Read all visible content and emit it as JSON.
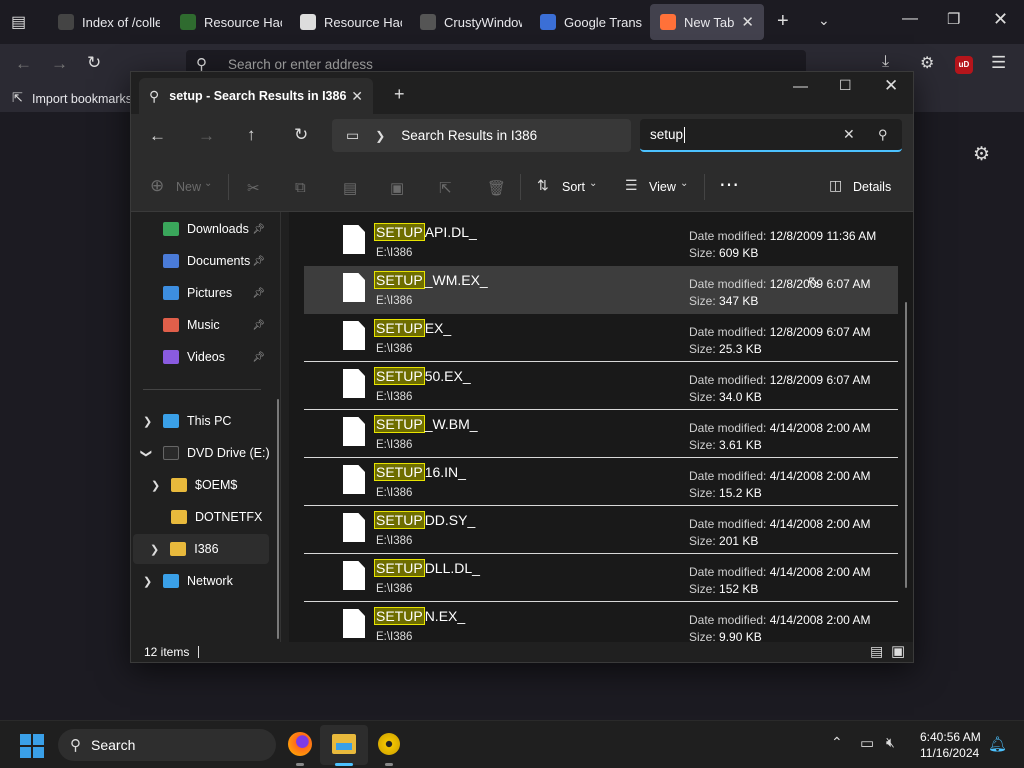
{
  "browser": {
    "tabs": [
      {
        "label": "Index of /colle",
        "icon": "wayback-icon"
      },
      {
        "label": "Resource Hack",
        "icon": "resource-hacker-icon"
      },
      {
        "label": "Resource Hack",
        "icon": "wikipedia-icon"
      },
      {
        "label": "CrustyWindow",
        "icon": "github-icon"
      },
      {
        "label": "Google Transla",
        "icon": "google-translate-icon"
      },
      {
        "label": "New Tab",
        "icon": "firefox-icon"
      }
    ],
    "address_placeholder": "Search or enter address",
    "bookmark_label": "Import bookmarks..."
  },
  "explorer": {
    "tab_title": "setup - Search Results in I386",
    "breadcrumb": "Search Results in I386",
    "search_value": "setup",
    "toolbar": {
      "new_label": "New",
      "sort_label": "Sort",
      "view_label": "View",
      "details_label": "Details"
    },
    "sidebar": {
      "quick_access": [
        {
          "label": "Downloads",
          "icon": "downloads-icon",
          "color": "#3aa65b"
        },
        {
          "label": "Documents",
          "icon": "documents-icon",
          "color": "#4a7bd8"
        },
        {
          "label": "Pictures",
          "icon": "pictures-icon",
          "color": "#3d8ee0"
        },
        {
          "label": "Music",
          "icon": "music-icon",
          "color": "#e05f4a"
        },
        {
          "label": "Videos",
          "icon": "videos-icon",
          "color": "#8a5be0"
        }
      ],
      "this_pc": "This PC",
      "dvd_drive": "DVD Drive (E:) L",
      "folders": [
        "$OEM$",
        "DOTNETFX",
        "I386"
      ],
      "network": "Network"
    },
    "results": [
      {
        "highlight": "SETUP",
        "rest": "API.DL_",
        "path": "E:\\I386",
        "date": "12/8/2009 11:36 AM",
        "size": "609 KB"
      },
      {
        "highlight": "SETUP",
        "rest": "_WM.EX_",
        "path": "E:\\I386",
        "date": "12/8/2009 6:07 AM",
        "size": "347 KB"
      },
      {
        "highlight": "SETUP",
        "rest": "EX_",
        "path": "E:\\I386",
        "date": "12/8/2009 6:07 AM",
        "size": "25.3 KB"
      },
      {
        "highlight": "SETUP",
        "rest": "50.EX_",
        "path": "E:\\I386",
        "date": "12/8/2009 6:07 AM",
        "size": "34.0 KB"
      },
      {
        "highlight": "SETUP",
        "rest": "_W.BM_",
        "path": "E:\\I386",
        "date": "4/14/2008 2:00 AM",
        "size": "3.61 KB"
      },
      {
        "highlight": "SETUP",
        "rest": "16.IN_",
        "path": "E:\\I386",
        "date": "4/14/2008 2:00 AM",
        "size": "15.2 KB"
      },
      {
        "highlight": "SETUP",
        "rest": "DD.SY_",
        "path": "E:\\I386",
        "date": "4/14/2008 2:00 AM",
        "size": "201 KB"
      },
      {
        "highlight": "SETUP",
        "rest": "DLL.DL_",
        "path": "E:\\I386",
        "date": "4/14/2008 2:00 AM",
        "size": "152 KB"
      },
      {
        "highlight": "SETUP",
        "rest": "N.EX_",
        "path": "E:\\I386",
        "date": "4/14/2008 2:00 AM",
        "size": "9.90 KB"
      }
    ],
    "date_label": "Date modified:",
    "size_label": "Size:",
    "status": "12 items"
  },
  "taskbar": {
    "search_label": "Search",
    "time": "6:40:56 AM",
    "date": "11/16/2024"
  }
}
